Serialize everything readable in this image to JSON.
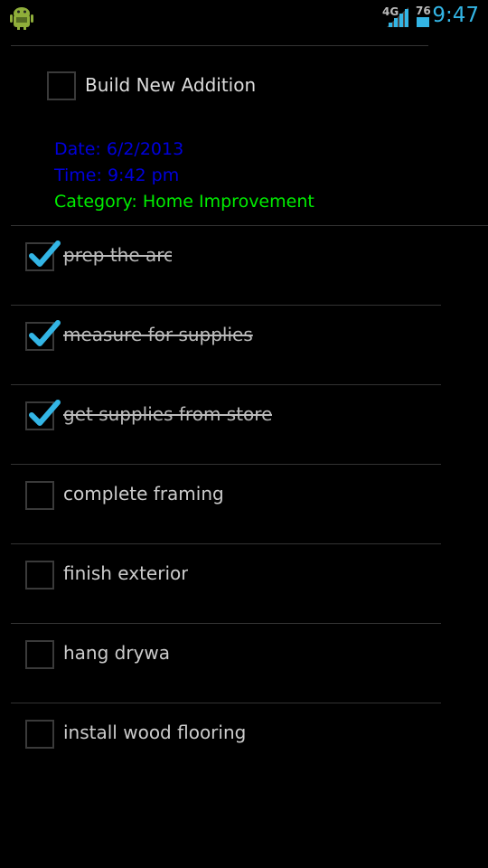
{
  "status_bar": {
    "network": "4G",
    "battery": "76",
    "time": "9:47",
    "icons": [
      "android-debug-icon",
      "signal-icon",
      "battery-icon"
    ]
  },
  "task": {
    "title": "Build New Addition",
    "checked": false,
    "date": "Date: 6/2/2013",
    "time": "Time: 9:42 pm",
    "category": "Category: Home Improvement"
  },
  "colors": {
    "accent": "#33b5e5",
    "date_time": "#0000dd",
    "category": "#00ee00"
  },
  "subtasks": [
    {
      "label": "prep the area",
      "checked": true
    },
    {
      "label": "measure for supplies",
      "checked": true
    },
    {
      "label": "get supplies from store",
      "checked": true
    },
    {
      "label": "complete framing",
      "checked": false
    },
    {
      "label": "finish exterior",
      "checked": false
    },
    {
      "label": "hang drywall",
      "checked": false
    },
    {
      "label": "install wood flooring",
      "checked": false
    }
  ]
}
